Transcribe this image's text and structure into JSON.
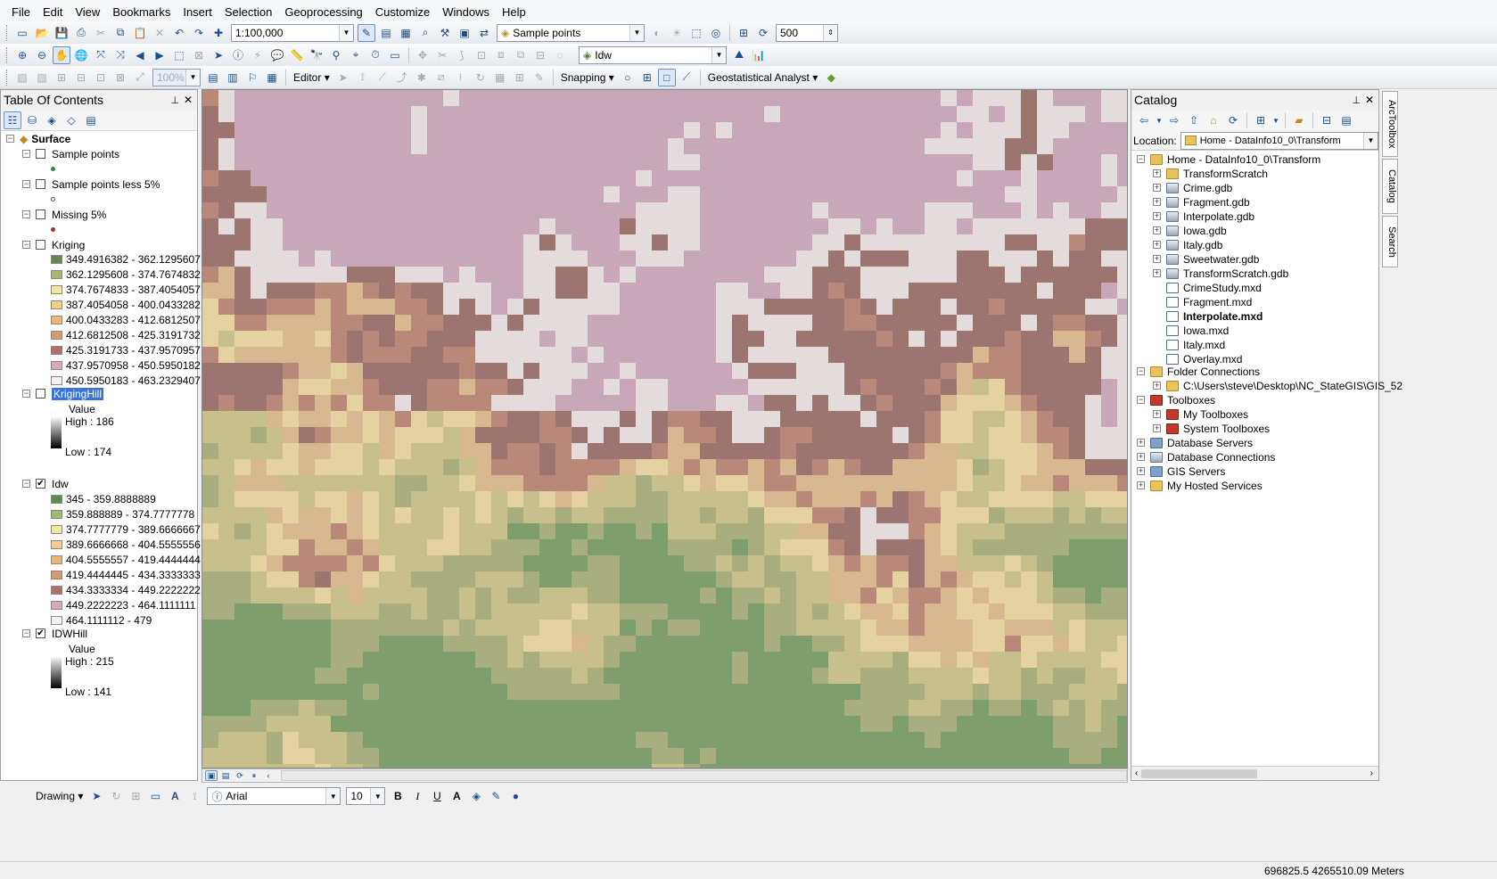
{
  "menu": [
    "File",
    "Edit",
    "View",
    "Bookmarks",
    "Insert",
    "Selection",
    "Geoprocessing",
    "Customize",
    "Windows",
    "Help"
  ],
  "toolbar": {
    "scale": "1:100,000",
    "target_layer": "Sample points",
    "raster_layer": "Idw",
    "number": "500",
    "editor_label": "Editor",
    "snapping_label": "Snapping",
    "geostat_label": "Geostatistical Analyst",
    "zoom_value": "100%"
  },
  "toc": {
    "title": "Table Of Contents",
    "group": "Surface",
    "layers": {
      "sample_points": "Sample points",
      "sample_less": "Sample points less 5%",
      "missing": "Missing 5%",
      "kriging": "Kriging",
      "kriging_hill": "KrigingHill",
      "idw": "Idw",
      "idw_hill": "IDWHill"
    },
    "kriging_classes": [
      {
        "label": "349.4916382 - 362.1295607",
        "color": "#5e8a52"
      },
      {
        "label": "362.1295608 - 374.7674832",
        "color": "#a4b874"
      },
      {
        "label": "374.7674833 - 387.4054057",
        "color": "#f0e8a0"
      },
      {
        "label": "387.4054058 - 400.0433282",
        "color": "#f2d08a"
      },
      {
        "label": "400.0433283 - 412.6812507",
        "color": "#e6b878"
      },
      {
        "label": "412.6812508 - 425.3191732",
        "color": "#d49a70"
      },
      {
        "label": "425.3191733 - 437.9570957",
        "color": "#b47068"
      },
      {
        "label": "437.9570958 - 450.5950182",
        "color": "#d8aab8"
      },
      {
        "label": "450.5950183 - 463.2329407",
        "color": "#f6eef2"
      }
    ],
    "kriging_hill": {
      "value_label": "Value",
      "high": "High : 186",
      "low": "Low : 174"
    },
    "idw_classes": [
      {
        "label": "345 - 359.8888889",
        "color": "#5e8a52"
      },
      {
        "label": "359.888889 - 374.7777778",
        "color": "#a4b874"
      },
      {
        "label": "374.7777779 - 389.6666667",
        "color": "#f0e8a0"
      },
      {
        "label": "389.6666668 - 404.5555556",
        "color": "#f2d08a"
      },
      {
        "label": "404.5555557 - 419.4444444",
        "color": "#e6b878"
      },
      {
        "label": "419.4444445 - 434.3333333",
        "color": "#d49a70"
      },
      {
        "label": "434.3333334 - 449.2222222",
        "color": "#b47068"
      },
      {
        "label": "449.2222223 - 464.1111111",
        "color": "#d8aab8"
      },
      {
        "label": "464.1111112 - 479",
        "color": "#f6eef2"
      }
    ],
    "idw_hill": {
      "value_label": "Value",
      "high": "High : 215",
      "low": "Low : 141"
    }
  },
  "catalog": {
    "title": "Catalog",
    "location_label": "Location:",
    "location_value": "Home - DataInfo10_0\\Transform",
    "home": "Home - DataInfo10_0\\Transform",
    "items": [
      {
        "label": "TransformScratch",
        "kind": "folder"
      },
      {
        "label": "Crime.gdb",
        "kind": "gdb"
      },
      {
        "label": "Fragment.gdb",
        "kind": "gdb"
      },
      {
        "label": "Interpolate.gdb",
        "kind": "gdb"
      },
      {
        "label": "Iowa.gdb",
        "kind": "gdb"
      },
      {
        "label": "Italy.gdb",
        "kind": "gdb"
      },
      {
        "label": "Sweetwater.gdb",
        "kind": "gdb"
      },
      {
        "label": "TransformScratch.gdb",
        "kind": "gdb"
      },
      {
        "label": "CrimeStudy.mxd",
        "kind": "mxd"
      },
      {
        "label": "Fragment.mxd",
        "kind": "mxd"
      },
      {
        "label": "Interpolate.mxd",
        "kind": "mxd",
        "bold": true
      },
      {
        "label": "Iowa.mxd",
        "kind": "mxd"
      },
      {
        "label": "Italy.mxd",
        "kind": "mxd"
      },
      {
        "label": "Overlay.mxd",
        "kind": "mxd"
      }
    ],
    "folder_connections": "Folder Connections",
    "folder_path": "C:\\Users\\steve\\Desktop\\NC_StateGIS\\GIS_52",
    "toolboxes": "Toolboxes",
    "my_toolboxes": "My Toolboxes",
    "system_toolboxes": "System Toolboxes",
    "database_servers": "Database Servers",
    "database_connections": "Database Connections",
    "gis_servers": "GIS Servers",
    "hosted_services": "My Hosted Services"
  },
  "side_tabs": [
    "ArcToolbox",
    "Catalog",
    "Search"
  ],
  "drawing": {
    "label": "Drawing",
    "font": "Arial",
    "size": "10"
  },
  "status": {
    "coords": "696825.5  4265510.09 Meters"
  },
  "map_colors": [
    "#a4b874",
    "#c8c08c",
    "#e6d2a0",
    "#d8b890",
    "#b88878",
    "#9c7470",
    "#c8a8b8",
    "#e4dcdc",
    "#7e9e6e",
    "#a8ae80"
  ]
}
